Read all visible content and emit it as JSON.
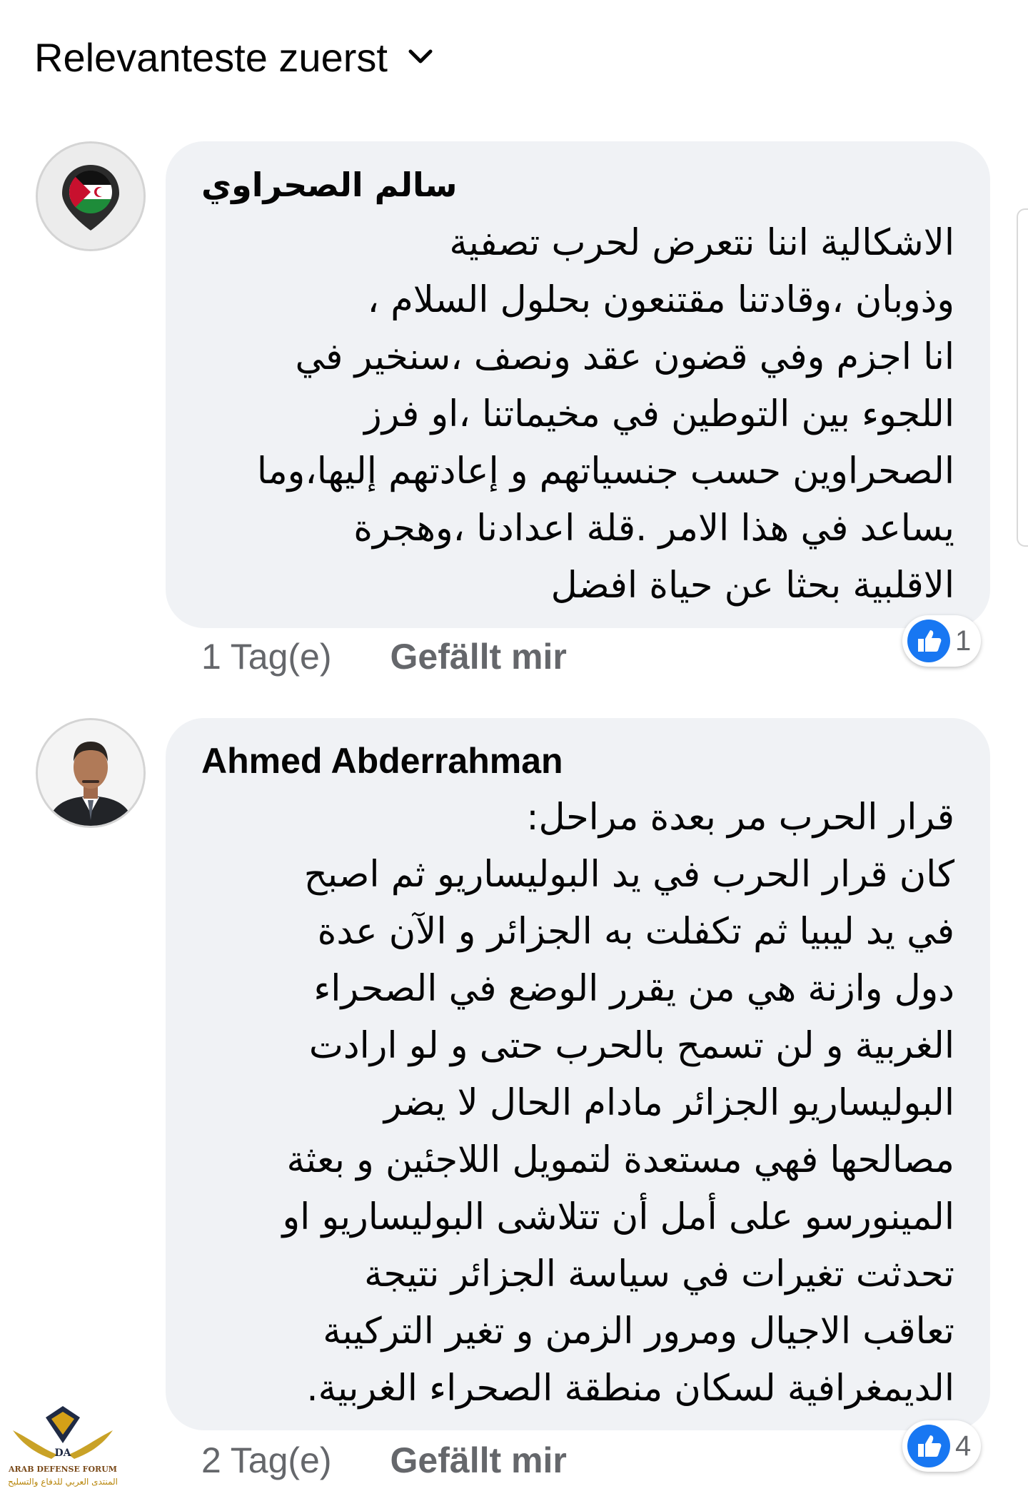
{
  "sort": {
    "label": "Relevanteste zuerst"
  },
  "comments": [
    {
      "author": "سالم الصحراوي",
      "avatar_icon": "sahrawi-flag-pin-icon",
      "text": "الاشكالية اننا نتعرض لحرب تصفية\nوذوبان ،وقادتنا مقتنعون بحلول السلام ،\nانا اجزم وفي قضون عقد ونصف ،سنخير في\nاللجوء بين التوطين في مخيماتنا ،او فرز\nالصحراوين حسب جنسياتهم و إعادتهم إليها،وما\nيساعد في هذا الامر .قلة اعدادنا ،وهجرة\nالاقلبية بحثا عن حياة افضل",
      "time": "1 Tag(e)",
      "like_label": "Gefällt mir",
      "reaction_count": "1"
    },
    {
      "author": "Ahmed Abderrahman",
      "avatar_icon": "profile-photo",
      "text": "قرار الحرب مر بعدة مراحل:\nكان قرار الحرب في يد البوليساريو ثم اصبح\nفي يد ليبيا ثم تكفلت به الجزائر و الآن عدة\nدول وازنة هي من يقرر الوضع في الصحراء\nالغربية و لن تسمح بالحرب حتى و لو ارادت\nالبوليساريو الجزائر مادام الحال لا يضر\nمصالحها فهي مستعدة لتمويل اللاجئين و بعثة\nالمينورسو  على أمل أن تتلاشى البوليساريو او\nتحدثت تغيرات في سياسة الجزائر نتيجة\nتعاقب الاجيال ومرور الزمن و تغير التركيبة\nالديمغرافية لسكان منطقة الصحراء الغربية.",
      "time": "2 Tag(e)",
      "like_label": "Gefällt mir",
      "reaction_count": "4"
    }
  ],
  "watermark": {
    "line1": "ARAB DEFENSE FORUM",
    "line2": "المنتدى العربي للدفاع والتسليح"
  },
  "colors": {
    "bubble": "#f0f2f5",
    "meta": "#65676b",
    "like_blue": "#1877f2"
  }
}
